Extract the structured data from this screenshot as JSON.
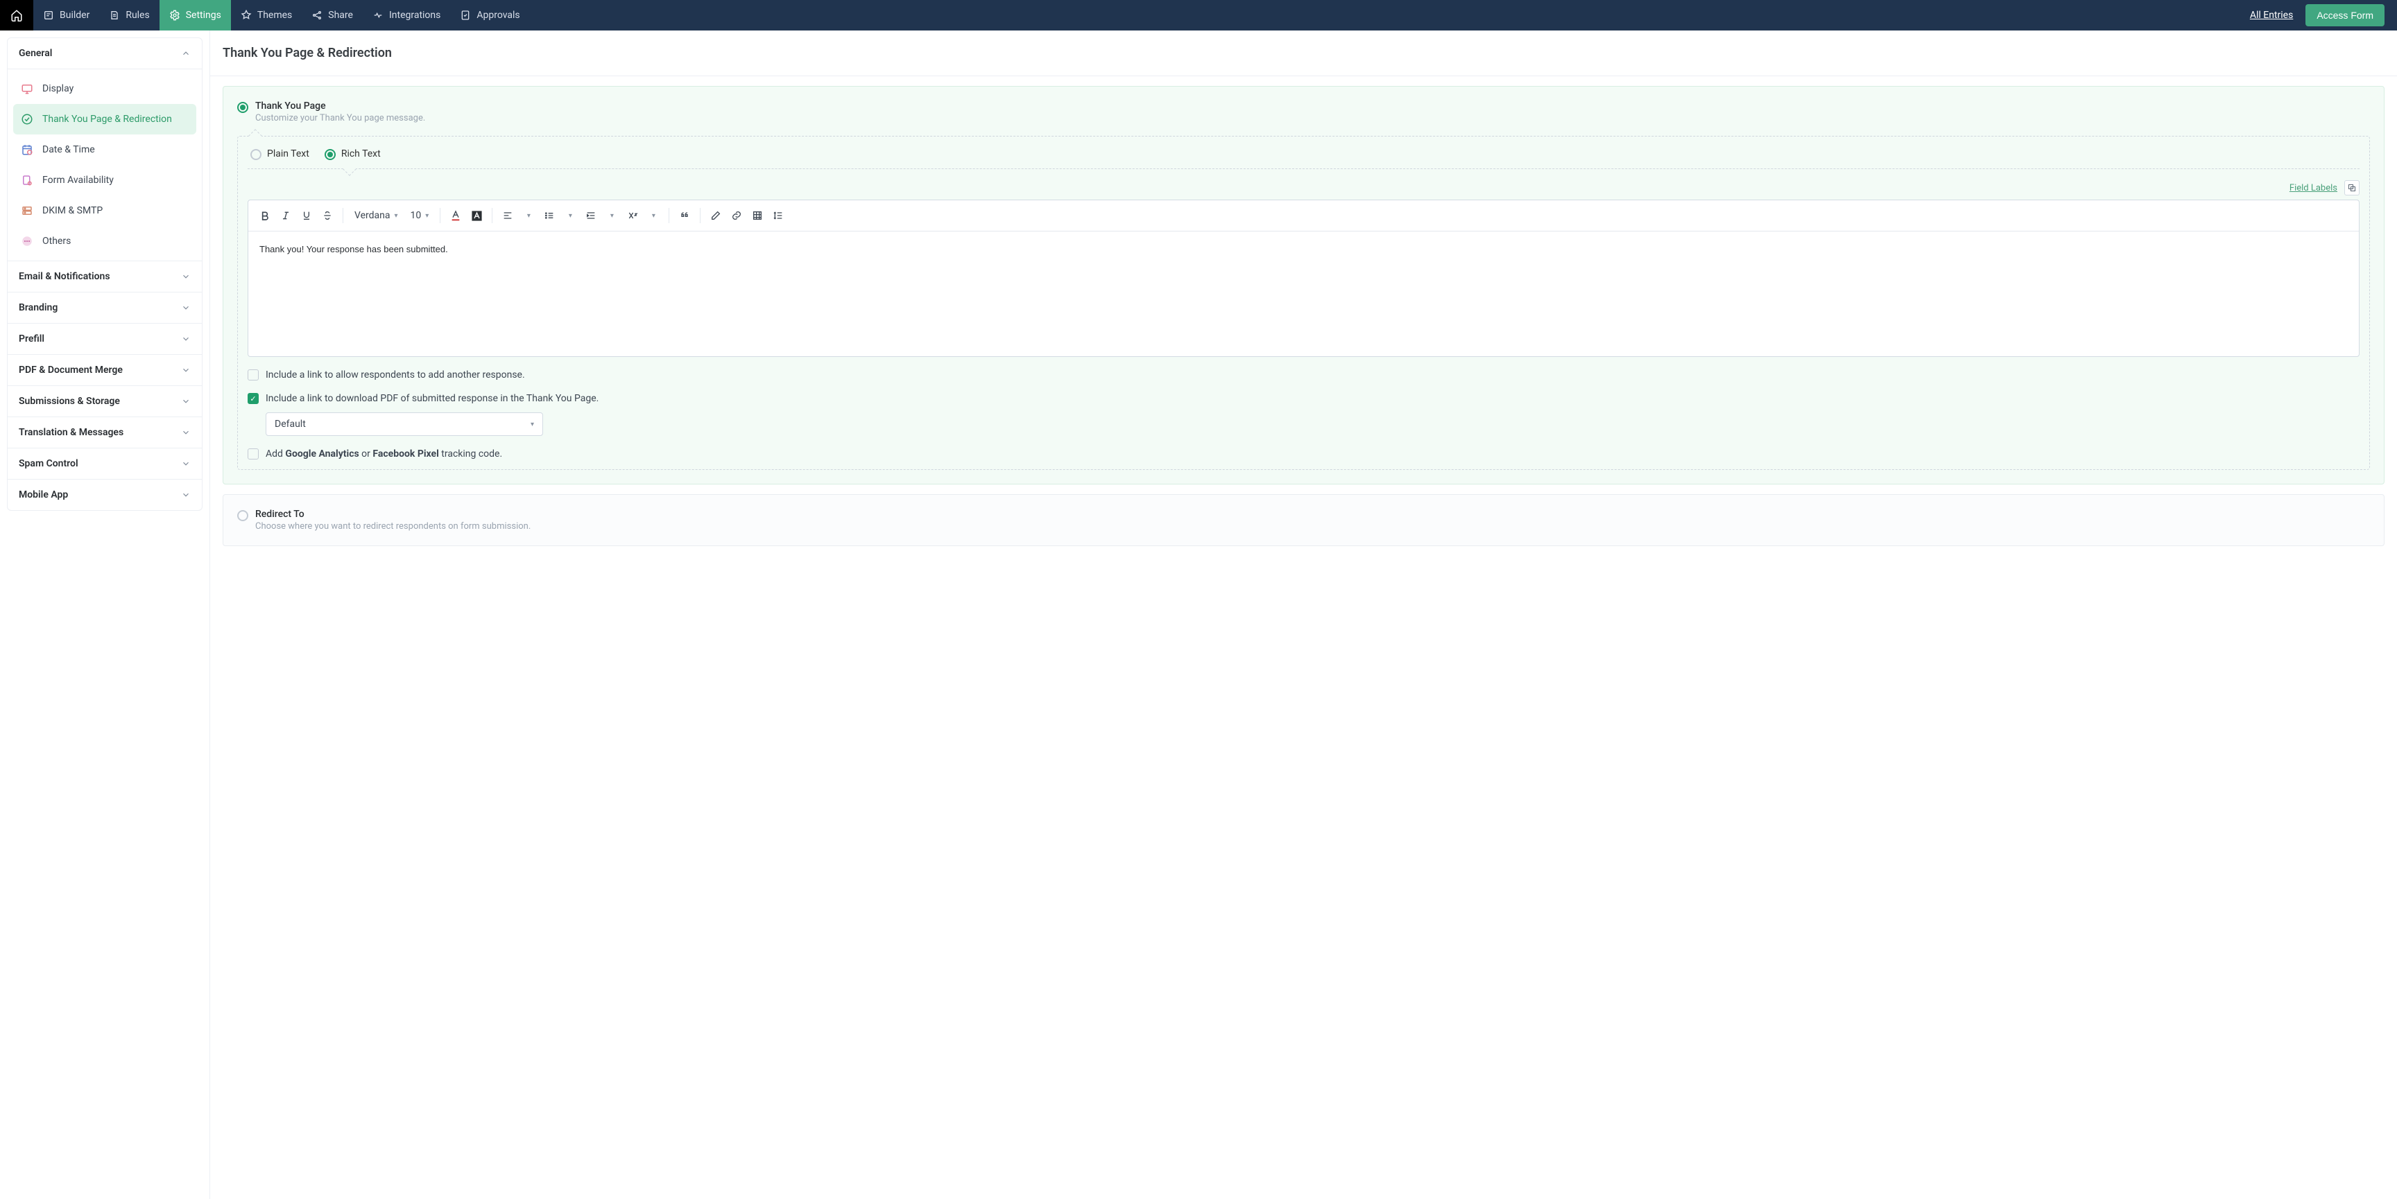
{
  "nav": {
    "items": [
      {
        "label": "Builder"
      },
      {
        "label": "Rules"
      },
      {
        "label": "Settings"
      },
      {
        "label": "Themes"
      },
      {
        "label": "Share"
      },
      {
        "label": "Integrations"
      },
      {
        "label": "Approvals"
      }
    ],
    "all_entries": "All Entries",
    "access_form": "Access Form"
  },
  "sidebar": {
    "general": {
      "title": "General",
      "items": [
        {
          "label": "Display"
        },
        {
          "label": "Thank You Page & Redirection"
        },
        {
          "label": "Date & Time"
        },
        {
          "label": "Form Availability"
        },
        {
          "label": "DKIM & SMTP"
        },
        {
          "label": "Others"
        }
      ]
    },
    "sections": [
      {
        "label": "Email & Notifications"
      },
      {
        "label": "Branding"
      },
      {
        "label": "Prefill"
      },
      {
        "label": "PDF & Document Merge"
      },
      {
        "label": "Submissions & Storage"
      },
      {
        "label": "Translation & Messages"
      },
      {
        "label": "Spam Control"
      },
      {
        "label": "Mobile App"
      }
    ]
  },
  "main": {
    "title": "Thank You Page & Redirection",
    "thankyou": {
      "title": "Thank You Page",
      "subtitle": "Customize your Thank You page message.",
      "plain_text": "Plain Text",
      "rich_text": "Rich Text",
      "field_labels": "Field Labels",
      "font": "Verdana",
      "size": "10",
      "body": "Thank you! Your response has been submitted.",
      "chk_another": "Include a link to allow respondents to add another response.",
      "chk_pdf": "Include a link to download PDF of submitted response in the Thank You Page.",
      "pdf_select": "Default",
      "ga_pre": "Add ",
      "ga_b1": "Google Analytics",
      "ga_mid": " or ",
      "ga_b2": "Facebook Pixel",
      "ga_post": " tracking code."
    },
    "redirect": {
      "title": "Redirect To",
      "subtitle": "Choose where you want to redirect respondents on form submission."
    }
  }
}
